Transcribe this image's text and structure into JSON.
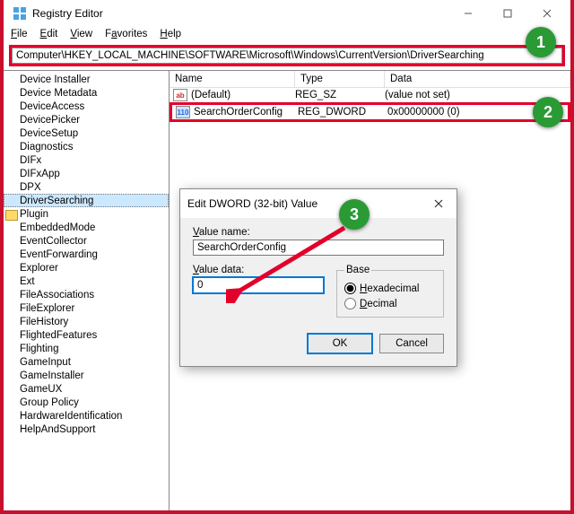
{
  "window": {
    "title": "Registry Editor",
    "min_tooltip": "Minimize",
    "max_tooltip": "Maximize",
    "close_tooltip": "Close"
  },
  "menu": {
    "file": "File",
    "edit": "Edit",
    "view": "View",
    "favorites": "Favorites",
    "help": "Help"
  },
  "address": "Computer\\HKEY_LOCAL_MACHINE\\SOFTWARE\\Microsoft\\Windows\\CurrentVersion\\DriverSearching",
  "tree": [
    "Device Installer",
    "Device Metadata",
    "DeviceAccess",
    "DevicePicker",
    "DeviceSetup",
    "Diagnostics",
    "DIFx",
    "DIFxApp",
    "DPX",
    "DriverSearching",
    "Plugin",
    "EmbeddedMode",
    "EventCollector",
    "EventForwarding",
    "Explorer",
    "Ext",
    "FileAssociations",
    "FileExplorer",
    "FileHistory",
    "FlightedFeatures",
    "Flighting",
    "GameInput",
    "GameInstaller",
    "GameUX",
    "Group Policy",
    "HardwareIdentification",
    "HelpAndSupport"
  ],
  "tree_selected_index": 9,
  "tree_folder_indexes": [
    10
  ],
  "list": {
    "cols": {
      "name": "Name",
      "type": "Type",
      "data": "Data"
    },
    "rows": [
      {
        "icon": "sz",
        "name": "(Default)",
        "type": "REG_SZ",
        "data": "(value not set)"
      },
      {
        "icon": "dw",
        "name": "SearchOrderConfig",
        "type": "REG_DWORD",
        "data": "0x00000000 (0)"
      }
    ],
    "highlight_index": 1
  },
  "dialog": {
    "title": "Edit DWORD (32-bit) Value",
    "name_label": "Value name:",
    "name_value": "SearchOrderConfig",
    "data_label": "Value data:",
    "data_value": "0",
    "base_label": "Base",
    "hex_label": "Hexadecimal",
    "dec_label": "Decimal",
    "ok": "OK",
    "cancel": "Cancel"
  },
  "steps": {
    "1": "1",
    "2": "2",
    "3": "3"
  }
}
